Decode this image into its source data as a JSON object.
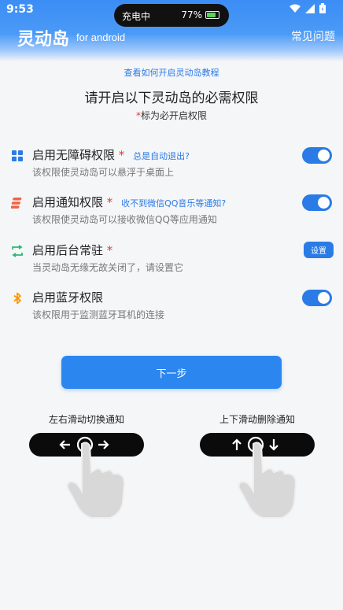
{
  "status": {
    "time": "9:53"
  },
  "island": {
    "left_text": "充电中",
    "battery_text": "77%",
    "battery_level": 0.77
  },
  "header": {
    "app_title": "灵动岛",
    "app_subtitle": "for android",
    "faq_label": "常见问题"
  },
  "tutorial_link": "查看如何开启灵动岛教程",
  "main_title": "请开启以下灵动岛的必需权限",
  "required_note": {
    "star": "*",
    "text": "标为必开启权限"
  },
  "permissions": [
    {
      "title": "启用无障碍权限",
      "star": "*",
      "hint": "总是自动退出?",
      "desc": "该权限使灵动岛可以悬浮于桌面上",
      "control": "toggle",
      "enabled": true,
      "icon": "grid-icon",
      "icon_color": "#2a7be6"
    },
    {
      "title": "启用通知权限",
      "star": "*",
      "hint": "收不到微信QQ音乐等通知?",
      "desc": "该权限使灵动岛可以接收微信QQ等应用通知",
      "control": "toggle",
      "enabled": true,
      "icon": "stack-icon",
      "icon_color": "#f06442"
    },
    {
      "title": "启用后台常驻",
      "star": "*",
      "hint": "",
      "desc": "当灵动岛无缘无故关闭了，请设置它",
      "control": "button",
      "button_label": "设置",
      "icon": "refresh-icon",
      "icon_color": "#2eb872"
    },
    {
      "title": "启用蓝牙权限",
      "star": "",
      "hint": "",
      "desc": "该权限用于监测蓝牙耳机的连接",
      "control": "toggle",
      "enabled": true,
      "icon": "bluetooth-icon",
      "icon_color": "#ff9800"
    }
  ],
  "next_button": "下一步",
  "gestures": [
    {
      "label": "左右滑动切换通知"
    },
    {
      "label": "上下滑动删除通知"
    }
  ],
  "colors": {
    "accent": "#2a7be6",
    "required": "#e53935"
  }
}
